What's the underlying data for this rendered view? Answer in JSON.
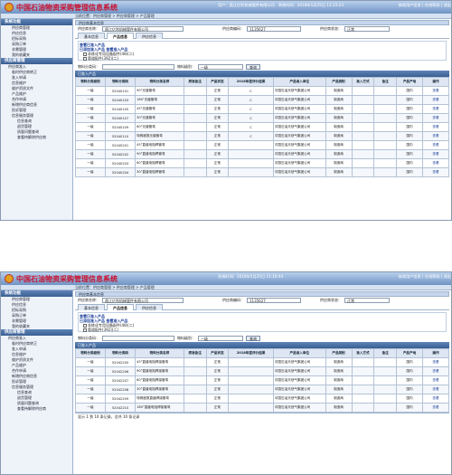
{
  "app": {
    "title": "中国石油物资采购管理信息系统",
    "user": "用户：昌江亿利机械管件有限公司",
    "time1": "系统时间：2018年5月25日 11:15:23",
    "time2": "系统时间：2018年5月25日 11:16:44",
    "links": "修改用户信息 | 在线帮助 | 退出"
  },
  "breadcrumb": "当前位置：供应商管理 > 供应商管理 > 产品管理",
  "sidebar": {
    "header1": "系统功能",
    "items1": [
      "供应商管理",
      "供应信息",
      "招标采购",
      "采购订单",
      "非需管理",
      "我的收藏夹"
    ],
    "header2": "供应商管理",
    "items2": [
      "供应商准入",
      "临时供应商转正",
      "准入申请",
      "信息维护",
      "维护资质文件",
      "产品维护",
      "合作申请",
      "新增供应商信息",
      "投诉管理",
      "信息服务管理",
      "信息查询",
      "退货管理",
      "质量问题查询",
      "查看待解除供应商"
    ]
  },
  "supplier": {
    "title": "供应商基本信息",
    "name_label": "供应商名称：",
    "name": "昌江亿利机械管件有限公司",
    "code_label": "供应商编码：",
    "code": "1135627",
    "status_label": "供应商状态：",
    "status": "正常"
  },
  "tabs": [
    "基本信息",
    "产品信息",
    "供应信息"
  ],
  "catalog": {
    "line1": "查看已准入产品",
    "line2": "已添加准入产品  查看准入产品",
    "node1": "非炼化专用设备配件(48)(二)",
    "node2": "管道配件(392)(二)"
  },
  "filter": {
    "code_label": "物料分类码：",
    "level_label": "物料级别：",
    "level_value": "一级",
    "query": "查询"
  },
  "table1": {
    "title": "已准入产品",
    "headers": [
      "物料分类级别",
      "物料分类码",
      "物料分类名称",
      "原准备注",
      "产品状态",
      "2018年度评价结果",
      "产品准入单位",
      "产品类别",
      "准入方式",
      "备注",
      "产品产地",
      "操作"
    ],
    "rows": [
      [
        "一级",
        "52040101",
        "90°无缝管弯",
        "",
        "正常",
        "C",
        "中国石油天然气集团公司",
        "制造商",
        "",
        "",
        "国内",
        "查看"
      ],
      [
        "一级",
        "52040103",
        "180°无缝管弯",
        "",
        "正常",
        "C",
        "中国石油天然气集团公司",
        "制造商",
        "",
        "",
        "国内",
        "查看"
      ],
      [
        "一级",
        "52040105",
        "45°无缝管弯",
        "",
        "正常",
        "C",
        "中国石油天然气集团公司",
        "制造商",
        "",
        "",
        "国内",
        "查看"
      ],
      [
        "一级",
        "52040107",
        "30°无缝管弯",
        "",
        "正常",
        "C",
        "中国石油天然气集团公司",
        "制造商",
        "",
        "",
        "国内",
        "查看"
      ],
      [
        "一级",
        "52040109",
        "60°无缝管弯",
        "",
        "正常",
        "C",
        "中国石油天然气集团公司",
        "制造商",
        "",
        "",
        "国内",
        "查看"
      ],
      [
        "一级",
        "52040110",
        "特殊度数无缝管弯",
        "",
        "正常",
        "C",
        "中国石油天然气集团公司",
        "制造商",
        "",
        "",
        "国内",
        "查看"
      ],
      [
        "一级",
        "52040201",
        "45°直缝电阻焊管弯",
        "",
        "正常",
        "",
        "中国石油天然气集团公司",
        "制造商",
        "",
        "",
        "国内",
        "查看"
      ],
      [
        "一级",
        "52040202",
        "90°直缝电阻焊管弯",
        "",
        "正常",
        "",
        "中国石油天然气集团公司",
        "制造商",
        "",
        "",
        "国内",
        "查看"
      ],
      [
        "一级",
        "52040203",
        "60°直缝电阻焊管弯",
        "",
        "正常",
        "",
        "中国石油天然气集团公司",
        "制造商",
        "",
        "",
        "国内",
        "查看"
      ],
      [
        "一级",
        "52040204",
        "30°直缝电阻焊管弯",
        "",
        "正常",
        "",
        "中国石油天然气集团公司",
        "制造商",
        "",
        "",
        "国内",
        "查看"
      ]
    ]
  },
  "table2": {
    "rows": [
      [
        "一级",
        "52042205",
        "45°直缝电阻焊接管弯",
        "",
        "正常",
        "",
        "中国石油天然气集团公司",
        "制造商",
        "",
        "",
        "国内",
        "查看"
      ],
      [
        "一级",
        "52042206",
        "90°直缝电阻焊接管弯",
        "",
        "正常",
        "",
        "中国石油天然气集团公司",
        "制造商",
        "",
        "",
        "国内",
        "查看"
      ],
      [
        "一级",
        "52042207",
        "60°直缝电阻焊接管弯",
        "",
        "正常",
        "",
        "中国石油天然气集团公司",
        "制造商",
        "",
        "",
        "国内",
        "查看"
      ],
      [
        "一级",
        "52042208",
        "30°直缝电阻焊接管弯",
        "",
        "正常",
        "",
        "中国石油天然气集团公司",
        "制造商",
        "",
        "",
        "国内",
        "查看"
      ],
      [
        "一级",
        "52042209",
        "特殊度数直缝焊接管弯",
        "",
        "正常",
        "",
        "中国石油天然气集团公司",
        "制造商",
        "",
        "",
        "国内",
        "查看"
      ],
      [
        "一级",
        "52042210",
        "180°直缝电阻焊接管弯",
        "",
        "正常",
        "",
        "中国石油天然气集团公司",
        "制造商",
        "",
        "",
        "国内",
        "查看"
      ]
    ],
    "pager": "显示 1 到 10 条记录，总共 10 条记录"
  }
}
